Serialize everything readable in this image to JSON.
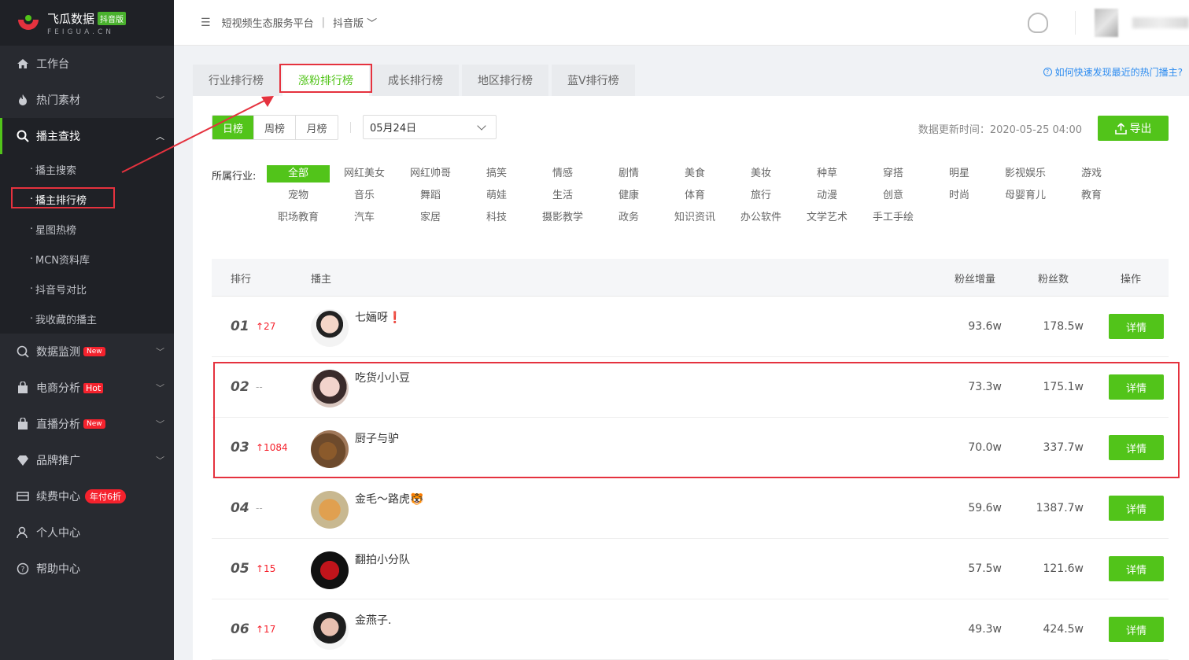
{
  "brand": {
    "name": "飞瓜数据",
    "badge": "抖音版",
    "sub": "FEIGUA.CN"
  },
  "sidebar": {
    "items": [
      {
        "label": "工作台",
        "icon": "home-icon"
      },
      {
        "label": "热门素材",
        "icon": "fire-icon"
      },
      {
        "label": "播主查找",
        "icon": "search-icon"
      },
      {
        "label": "数据监测",
        "icon": "monitor-icon",
        "tag": "New"
      },
      {
        "label": "电商分析",
        "icon": "bag-icon",
        "tag": "Hot"
      },
      {
        "label": "直播分析",
        "icon": "live-icon",
        "tag": "New"
      },
      {
        "label": "品牌推广",
        "icon": "diamond-icon"
      },
      {
        "label": "续费中心",
        "icon": "card-icon",
        "tag": "年付6折"
      },
      {
        "label": "个人中心",
        "icon": "user-icon"
      },
      {
        "label": "帮助中心",
        "icon": "help-icon"
      }
    ],
    "subitems": [
      "播主搜索",
      "播主排行榜",
      "星图热榜",
      "MCN资料库",
      "抖音号对比",
      "我收藏的播主"
    ]
  },
  "header": {
    "platform": "短视频生态服务平台",
    "sep": "|",
    "version": "抖音版"
  },
  "tabs": [
    "行业排行榜",
    "涨粉排行榜",
    "成长排行榜",
    "地区排行榜",
    "蓝V排行榜"
  ],
  "help_link": "如何快速发现最近的热门播主?",
  "periods": [
    "日榜",
    "周榜",
    "月榜"
  ],
  "date": "05月24日",
  "update_time": "数据更新时间：2020-05-25 04:00",
  "export": "导出",
  "industry_label": "所属行业:",
  "industries": [
    [
      "全部",
      "网红美女",
      "网红帅哥",
      "搞笑",
      "情感",
      "剧情",
      "美食",
      "美妆",
      "种草",
      "穿搭",
      "明星",
      "影视娱乐",
      "游戏"
    ],
    [
      "宠物",
      "音乐",
      "舞蹈",
      "萌娃",
      "生活",
      "健康",
      "体育",
      "旅行",
      "动漫",
      "创意",
      "时尚",
      "母婴育儿",
      "教育"
    ],
    [
      "职场教育",
      "汽车",
      "家居",
      "科技",
      "摄影教学",
      "政务",
      "知识资讯",
      "办公软件",
      "文学艺术",
      "手工手绘"
    ]
  ],
  "table": {
    "headers": {
      "rank": "排行",
      "anchor": "播主",
      "increase": "粉丝增量",
      "fans": "粉丝数",
      "action": "操作"
    },
    "rows": [
      {
        "rank": "01",
        "change": "↑27",
        "name": "七婳呀❗",
        "increase": "93.6w",
        "fans": "178.5w",
        "action": "详情"
      },
      {
        "rank": "02",
        "change": "--",
        "name": "吃货小小豆",
        "increase": "73.3w",
        "fans": "175.1w",
        "action": "详情"
      },
      {
        "rank": "03",
        "change": "↑1084",
        "name": "厨子与驴",
        "increase": "70.0w",
        "fans": "337.7w",
        "action": "详情"
      },
      {
        "rank": "04",
        "change": "--",
        "name": "金毛～路虎🐯",
        "increase": "59.6w",
        "fans": "1387.7w",
        "action": "详情"
      },
      {
        "rank": "05",
        "change": "↑15",
        "name": "翻拍小分队",
        "increase": "57.5w",
        "fans": "121.6w",
        "action": "详情"
      },
      {
        "rank": "06",
        "change": "↑17",
        "name": "金燕子.",
        "increase": "49.3w",
        "fans": "424.5w",
        "action": "详情"
      }
    ]
  },
  "colors": {
    "accent": "#52c41a",
    "sidebar_bg": "#282a30",
    "highlight": "#e5323e",
    "link": "#2d8cf0"
  }
}
